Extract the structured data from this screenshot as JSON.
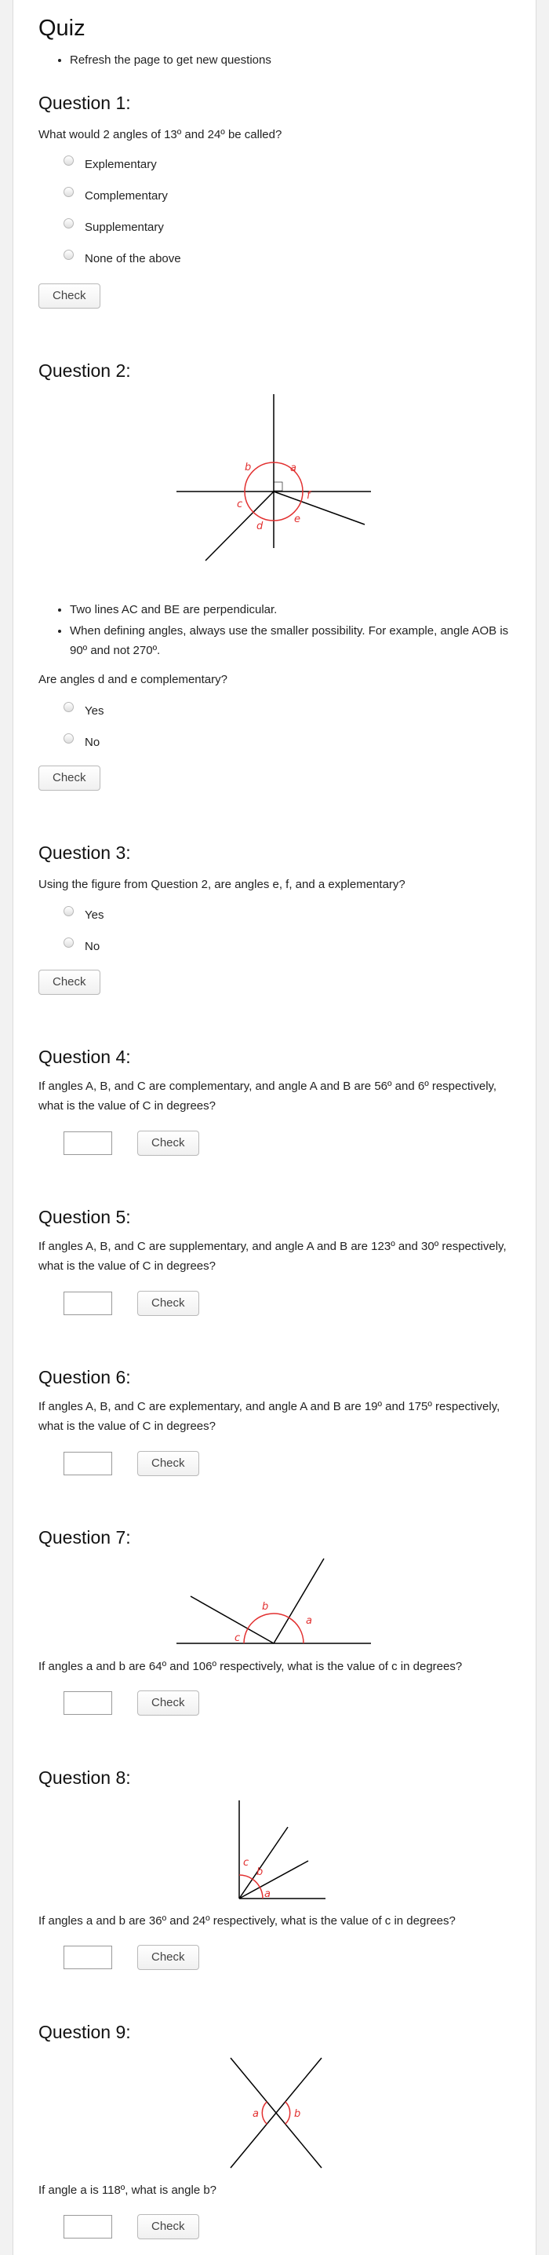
{
  "title": "Quiz",
  "intro": "Refresh the page to get new questions",
  "check_label": "Check",
  "colors": {
    "angle_marks": "#e23030",
    "lines": "#000000"
  },
  "questions": [
    {
      "heading": "Question 1:",
      "text": "What would 2 angles of 13º and 24º be called?",
      "options": [
        "Explementary",
        "Complementary",
        "Supplementary",
        "None of the above"
      ]
    },
    {
      "heading": "Question 2:",
      "figure_labels": [
        "a",
        "b",
        "c",
        "d",
        "e",
        "f"
      ],
      "bullets": [
        "Two lines AC and BE are perpendicular.",
        "When defining angles, always use the smaller possibility. For example, angle AOB is 90º and not 270º."
      ],
      "text": "Are angles d and e complementary?",
      "options": [
        "Yes",
        "No"
      ]
    },
    {
      "heading": "Question 3:",
      "text": "Using the figure from Question 2, are angles e, f, and a explementary?",
      "options": [
        "Yes",
        "No"
      ]
    },
    {
      "heading": "Question 4:",
      "text": "If angles A, B, and C are complementary, and angle A and B are 56º and 6º respectively, what is the value of C in degrees?"
    },
    {
      "heading": "Question 5:",
      "text": "If angles A, B, and C are supplementary, and angle A and B are 123º and 30º respectively, what is the value of C in degrees?"
    },
    {
      "heading": "Question 6:",
      "text": "If angles A, B, and C are explementary, and angle A and B are 19º and 175º respectively, what is the value of C in degrees?"
    },
    {
      "heading": "Question 7:",
      "figure_labels": [
        "a",
        "b",
        "c"
      ],
      "text": "If angles a and b are 64º and 106º respectively, what is the value of c in degrees?"
    },
    {
      "heading": "Question 8:",
      "figure_labels": [
        "a",
        "b",
        "c"
      ],
      "text": "If angles a and b are 36º and 24º respectively, what is the value of c in degrees?"
    },
    {
      "heading": "Question 9:",
      "figure_labels": [
        "a",
        "b"
      ],
      "text": "If angle a is 118º, what is angle b?"
    }
  ]
}
